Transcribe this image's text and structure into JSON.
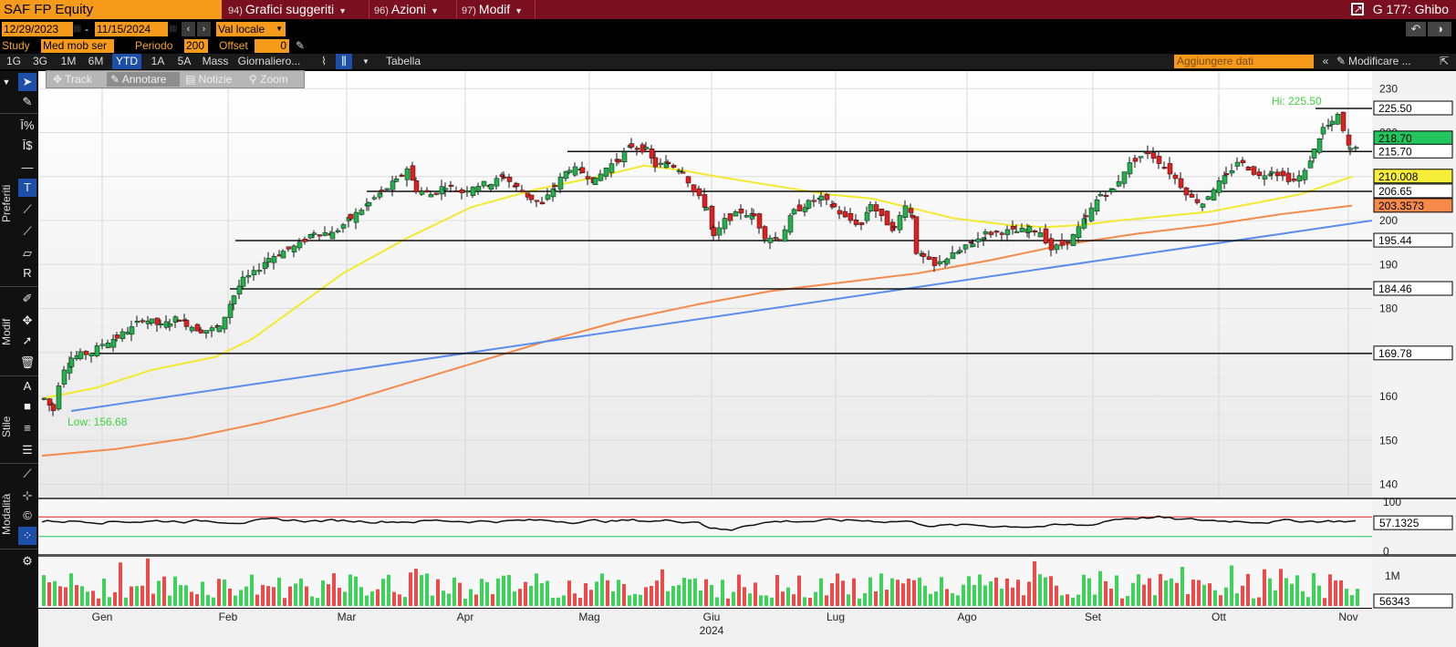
{
  "title_bar": {
    "ticker": "SAF FP Equity",
    "menus": [
      {
        "num": "94)",
        "label": "Grafici suggeriti"
      },
      {
        "num": "96)",
        "label": "Azioni"
      },
      {
        "num": "97)",
        "label": "Modif"
      }
    ],
    "window_label": "G 177: Ghibo"
  },
  "range": {
    "start_date": "12/29/2023",
    "dash": "-",
    "end_date": "11/15/2024",
    "currency": "Val locale"
  },
  "study": {
    "study_label": "Study",
    "study_value": "Med mob ser",
    "period_label": "Periodo",
    "period_value": "200",
    "offset_label": "Offset",
    "offset_value": "0"
  },
  "timeframes": [
    "1G",
    "3G",
    "1M",
    "6M",
    "YTD",
    "1A",
    "5A",
    "Mass",
    "Giornaliero..."
  ],
  "active_timeframe": "YTD",
  "tabella_label": "Tabella",
  "add_data_placeholder": "Aggiungere dati",
  "modify_label": "Modificare ...",
  "annotation_toolbar": [
    "Track",
    "Annotare",
    "Notizie",
    "Zoom"
  ],
  "active_annotation": "Annotare",
  "left_sections": [
    "Preferiti",
    "Modif",
    "Stile",
    "Modalità"
  ],
  "colors": {
    "accent_orange": "#f59a1b",
    "title_bg": "#7a0f1f",
    "candle_up": "#22b14c",
    "candle_down": "#e0201e",
    "ma50": "#f2ea2e",
    "ma200": "#f58a4a",
    "trendline": "#5b8def",
    "hi_low_text": "#3fd23f"
  },
  "chart_data": {
    "type": "candlestick",
    "y_axis_ticks": [
      230,
      220,
      210,
      200,
      190,
      180,
      170,
      160,
      150,
      140
    ],
    "ylim": [
      137,
      234
    ],
    "x_axis_months": [
      "Gen",
      "Feb",
      "Mar",
      "Apr",
      "Mag",
      "Giu",
      "Lug",
      "Ago",
      "Set",
      "Ott",
      "Nov"
    ],
    "x_axis_year": "2024",
    "hi_label": "Hi: 225.50",
    "low_label": "Low: 156.68",
    "horizontal_levels": [
      225.5,
      215.7,
      206.65,
      195.44,
      184.46,
      169.78
    ],
    "price_tags": [
      {
        "value": "225.50",
        "style": "white"
      },
      {
        "value": "218.70",
        "style": "green"
      },
      {
        "value": "215.70",
        "style": "white"
      },
      {
        "value": "210.008",
        "style": "yellow"
      },
      {
        "value": "206.65",
        "style": "white"
      },
      {
        "value": "203.3573",
        "style": "orange"
      },
      {
        "value": "195.44",
        "style": "white"
      },
      {
        "value": "184.46",
        "style": "white"
      },
      {
        "value": "169.78",
        "style": "white"
      }
    ],
    "rsi": {
      "ticks": [
        100,
        0
      ],
      "last_value": "57.1325",
      "upper": 70,
      "lower": 30
    },
    "volume": {
      "ticks": [
        "1M"
      ],
      "last_value": "56343"
    }
  }
}
